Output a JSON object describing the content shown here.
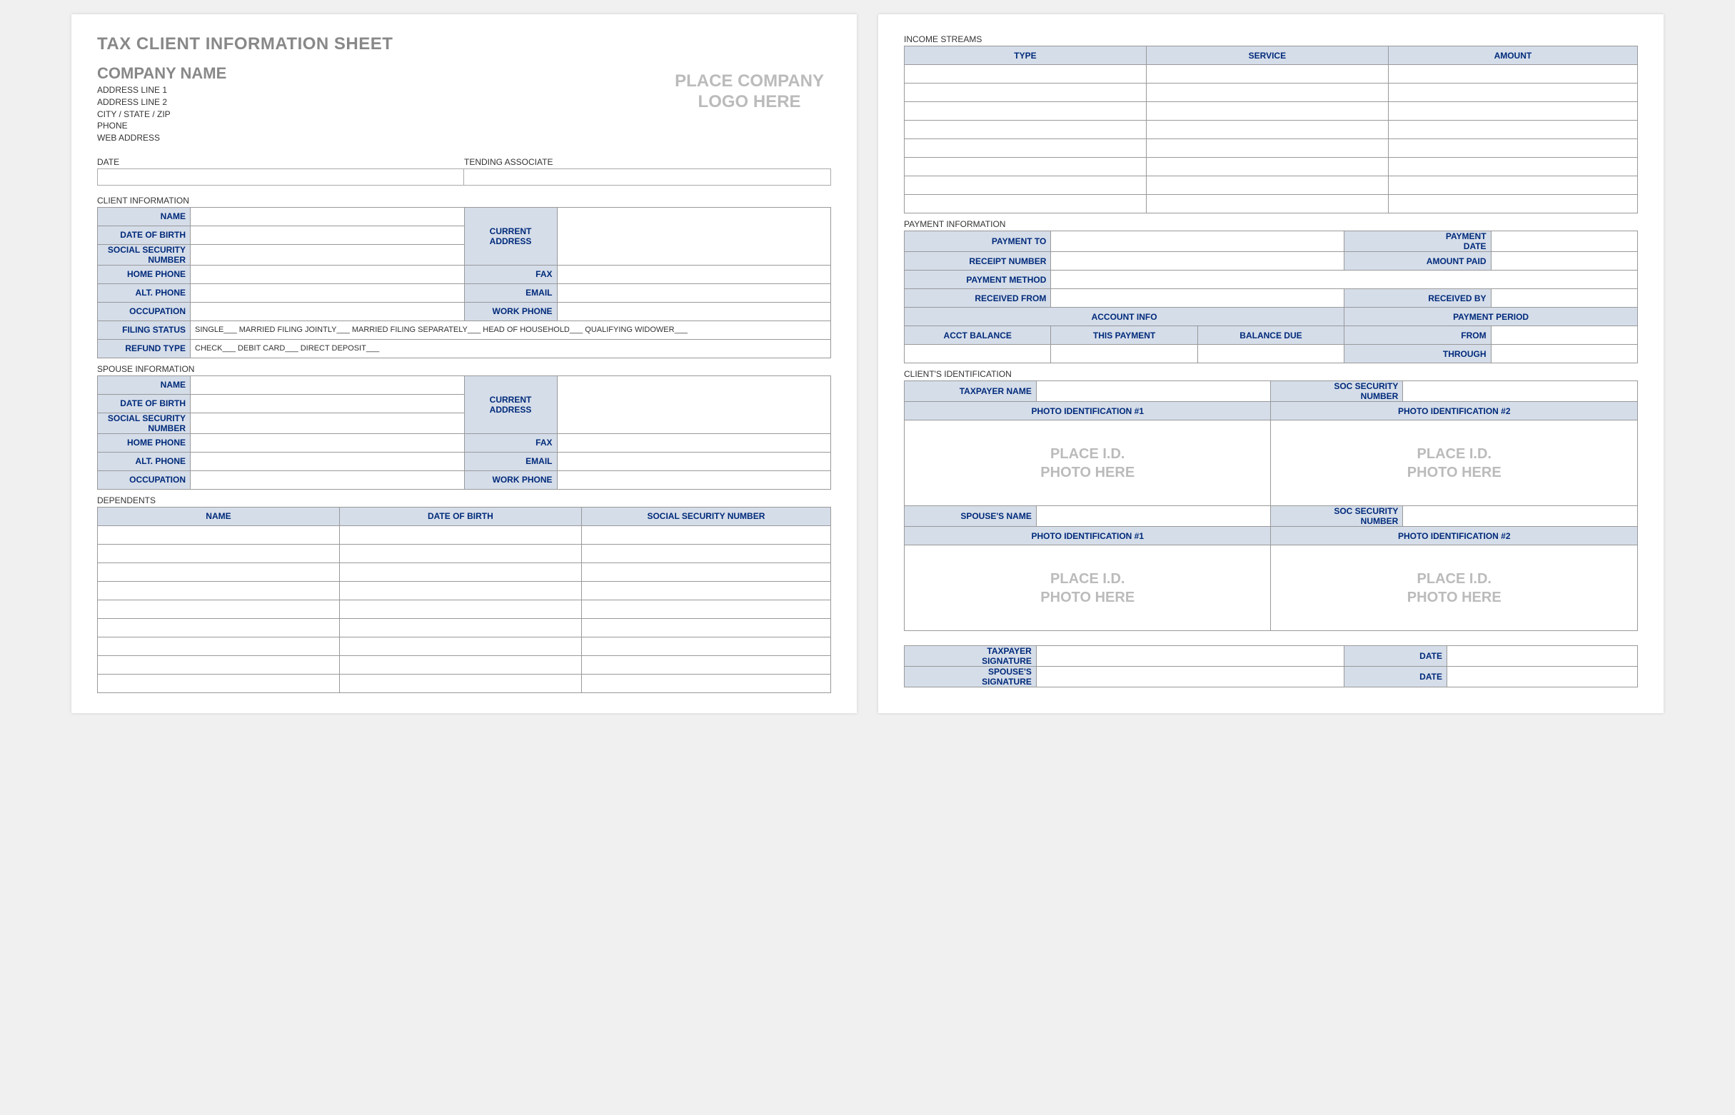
{
  "title": "TAX CLIENT INFORMATION SHEET",
  "company": "COMPANY NAME",
  "addr1": "ADDRESS LINE 1",
  "addr2": "ADDRESS LINE 2",
  "addr3": "CITY / STATE / ZIP",
  "addr4": "PHONE",
  "addr5": "WEB ADDRESS",
  "logo_ph": "PLACE COMPANY\nLOGO HERE",
  "date_lbl": "DATE",
  "tending_lbl": "TENDING ASSOCIATE",
  "sec_client": "CLIENT INFORMATION",
  "sec_spouse": "SPOUSE INFORMATION",
  "sec_dep": "DEPENDENTS",
  "sec_income": "INCOME STREAMS",
  "sec_payment": "PAYMENT INFORMATION",
  "sec_ident": "CLIENT'S IDENTIFICATION",
  "f": {
    "name": "NAME",
    "dob": "DATE OF BIRTH",
    "ssn": "SOCIAL SECURITY NUMBER",
    "ssn2": "SOCIAL SECURITY\nNUMBER",
    "homeph": "HOME PHONE",
    "altph": "ALT. PHONE",
    "occup": "OCCUPATION",
    "filing": "FILING STATUS",
    "refund": "REFUND TYPE",
    "curaddr": "CURRENT\nADDRESS",
    "fax": "FAX",
    "email": "EMAIL",
    "workph": "WORK PHONE",
    "filing_txt": "SINGLE___   MARRIED FILING JOINTLY___   MARRIED FILING SEPARATELY___   HEAD OF HOUSEHOLD___   QUALIFYING WIDOWER___",
    "refund_txt": "CHECK___   DEBIT CARD___   DIRECT DEPOSIT___"
  },
  "income": {
    "type": "TYPE",
    "service": "SERVICE",
    "amount": "AMOUNT"
  },
  "pay": {
    "to": "PAYMENT TO",
    "date": "PAYMENT\nDATE",
    "receipt": "RECEIPT NUMBER",
    "amtpaid": "AMOUNT PAID",
    "method": "PAYMENT METHOD",
    "recvfrom": "RECEIVED FROM",
    "recvby": "RECEIVED BY",
    "acctinfo": "ACCOUNT INFO",
    "period": "PAYMENT PERIOD",
    "acctbal": "ACCT BALANCE",
    "thispay": "THIS PAYMENT",
    "baldue": "BALANCE DUE",
    "from": "FROM",
    "through": "THROUGH"
  },
  "ident": {
    "taxname": "TAXPAYER NAME",
    "socsec": "SOC SECURITY\nNUMBER",
    "photo1": "PHOTO IDENTIFICATION #1",
    "photo2": "PHOTO IDENTIFICATION #2",
    "spname": "SPOUSE'S NAME",
    "photo_ph": "PLACE I.D.\nPHOTO HERE",
    "taxsig": "TAXPAYER\nSIGNATURE",
    "spsig": "SPOUSE'S\nSIGNATURE",
    "date": "DATE"
  }
}
